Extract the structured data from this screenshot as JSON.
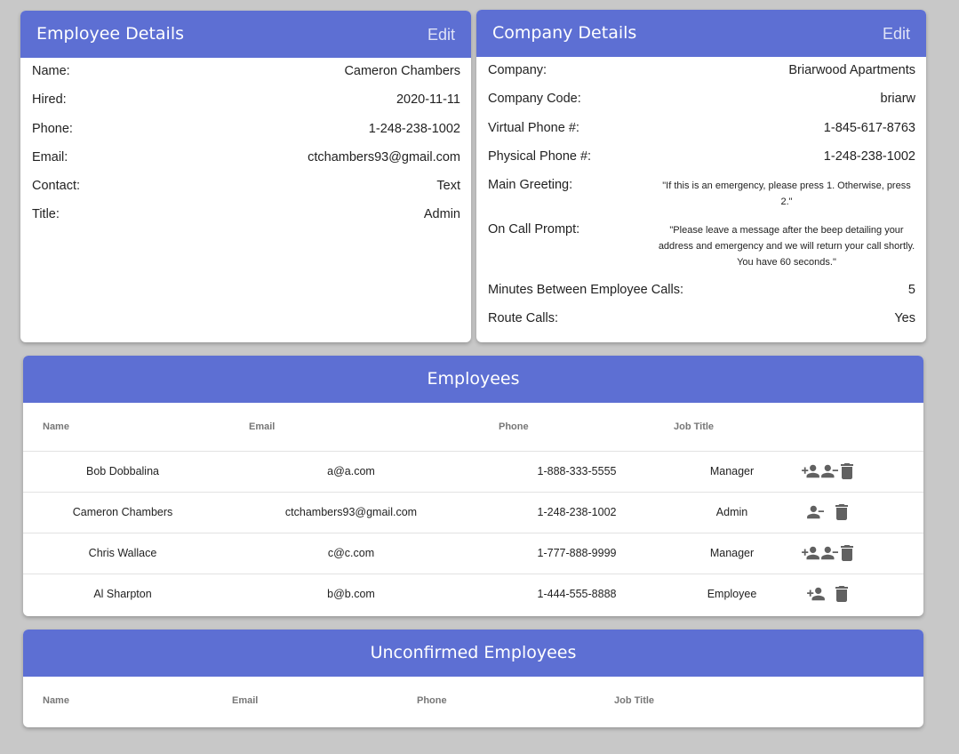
{
  "employee_details": {
    "title": "Employee Details",
    "edit_label": "Edit",
    "rows": [
      {
        "label": "Name:",
        "value": "Cameron Chambers"
      },
      {
        "label": "Hired:",
        "value": "2020-11-11"
      },
      {
        "label": "Phone:",
        "value": "1-248-238-1002"
      },
      {
        "label": "Email:",
        "value": "ctchambers93@gmail.com"
      },
      {
        "label": "Contact:",
        "value": "Text"
      },
      {
        "label": "Title:",
        "value": "Admin"
      }
    ]
  },
  "company_details": {
    "title": "Company Details",
    "edit_label": "Edit",
    "rows": [
      {
        "label": "Company:",
        "value": "Briarwood Apartments"
      },
      {
        "label": "Company Code:",
        "value": "briarw"
      },
      {
        "label": "Virtual Phone #:",
        "value": "1-845-617-8763"
      },
      {
        "label": "Physical Phone #:",
        "value": "1-248-238-1002"
      },
      {
        "label": "Main Greeting:",
        "value": "\"If this is an emergency, please press 1. Otherwise, press 2.\""
      },
      {
        "label": "On Call Prompt:",
        "value": "\"Please leave a message after the beep detailing your address and emergency and we will return your call shortly. You have 60 seconds.\""
      },
      {
        "label": "Minutes Between Employee Calls:",
        "value": "5"
      },
      {
        "label": "Route Calls:",
        "value": "Yes"
      }
    ]
  },
  "employees": {
    "title": "Employees",
    "headers": [
      "Name",
      "Email",
      "Phone",
      "Job Title"
    ],
    "rows": [
      {
        "name": "Bob Dobbalina",
        "email": "a@a.com",
        "phone": "1-888-333-5555",
        "job_title": "Manager",
        "actions": [
          "person-add-icon",
          "person-remove-icon",
          "trash-icon"
        ]
      },
      {
        "name": "Cameron Chambers",
        "email": "ctchambers93@gmail.com",
        "phone": "1-248-238-1002",
        "job_title": "Admin",
        "actions": [
          "person-remove-icon",
          "trash-icon"
        ]
      },
      {
        "name": "Chris Wallace",
        "email": "c@c.com",
        "phone": "1-777-888-9999",
        "job_title": "Manager",
        "actions": [
          "person-add-icon",
          "person-remove-icon",
          "trash-icon"
        ]
      },
      {
        "name": "Al Sharpton",
        "email": "b@b.com",
        "phone": "1-444-555-8888",
        "job_title": "Employee",
        "actions": [
          "person-add-icon",
          "trash-icon"
        ]
      }
    ]
  },
  "unconfirmed_employees": {
    "title": "Unconfirmed Employees",
    "headers": [
      "Name",
      "Email",
      "Phone",
      "Job Title"
    ],
    "rows": []
  },
  "colors": {
    "header_accent": "#5d6fd3",
    "background": "#c8c8c8",
    "icon_gray": "#616161"
  }
}
